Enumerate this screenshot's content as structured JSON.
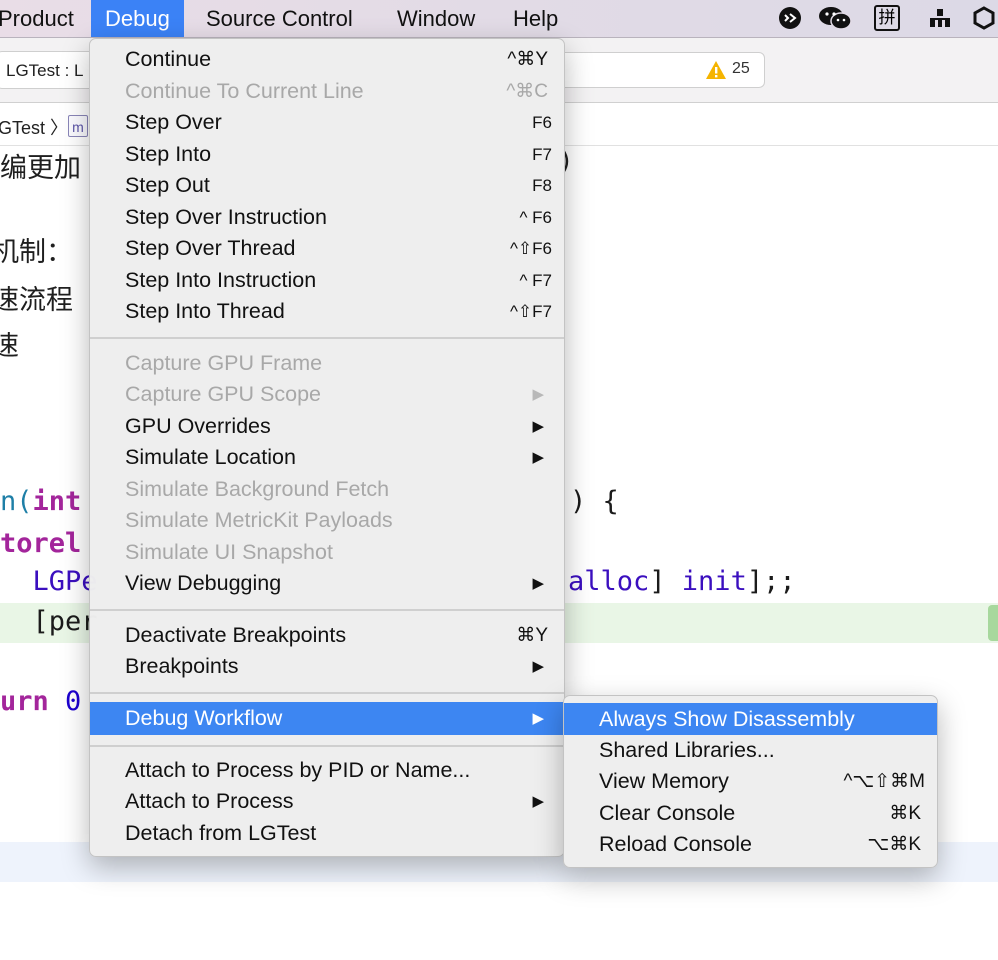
{
  "menubar": {
    "items": [
      {
        "label": "Product"
      },
      {
        "label": "Debug"
      },
      {
        "label": "Source Control"
      },
      {
        "label": "Window"
      },
      {
        "label": "Help"
      }
    ],
    "tray_icons": [
      "cat-icon",
      "wechat-icon",
      "pinyin-input-icon",
      "dock-icon",
      "hexagon-icon"
    ],
    "tray_text": {
      "pinyin": "拼"
    }
  },
  "toolbar": {
    "scheme": "LGTest : L",
    "warnings": "25"
  },
  "jumpbar": {
    "crumb": "GTest 〉",
    "file_badge": "m"
  },
  "editor": {
    "lines": [
      {
        "text": "编更加"
      },
      {
        "text": ")"
      },
      {
        "text": "机制："
      },
      {
        "text": "速流程"
      },
      {
        "text": "速"
      },
      {
        "pre": "n(",
        "kw": "int",
        "post": ""
      },
      {
        "suffix": ") {"
      },
      {
        "kw": "torel"
      },
      {
        "text": "  LGPe"
      },
      {
        "method": "alloc",
        "method2": "init",
        "tail": "];;"
      },
      {
        "text": "  [per"
      },
      {
        "kw": "urn",
        "num": "0"
      }
    ]
  },
  "debug_menu": {
    "items": [
      {
        "label": "Continue",
        "shortcut": "^⌘Y",
        "enabled": true
      },
      {
        "label": "Continue To Current Line",
        "shortcut": "^⌘C",
        "enabled": false
      },
      {
        "label": "Step Over",
        "shortcut": "F6",
        "enabled": true
      },
      {
        "label": "Step Into",
        "shortcut": "F7",
        "enabled": true
      },
      {
        "label": "Step Out",
        "shortcut": "F8",
        "enabled": true
      },
      {
        "label": "Step Over Instruction",
        "shortcut": "^ F6",
        "enabled": true
      },
      {
        "label": "Step Over Thread",
        "shortcut": "^⇧F6",
        "enabled": true
      },
      {
        "label": "Step Into Instruction",
        "shortcut": "^ F7",
        "enabled": true
      },
      {
        "label": "Step Into Thread",
        "shortcut": "^⇧F7",
        "enabled": true
      },
      {
        "label": "Capture GPU Frame",
        "enabled": false
      },
      {
        "label": "Capture GPU Scope",
        "submenu": true,
        "enabled": false
      },
      {
        "label": "GPU Overrides",
        "submenu": true,
        "enabled": true
      },
      {
        "label": "Simulate Location",
        "submenu": true,
        "enabled": true
      },
      {
        "label": "Simulate Background Fetch",
        "enabled": false
      },
      {
        "label": "Simulate MetricKit Payloads",
        "enabled": false
      },
      {
        "label": "Simulate UI Snapshot",
        "enabled": false
      },
      {
        "label": "View Debugging",
        "submenu": true,
        "enabled": true
      },
      {
        "label": "Deactivate Breakpoints",
        "shortcut": "⌘Y",
        "enabled": true
      },
      {
        "label": "Breakpoints",
        "submenu": true,
        "enabled": true
      },
      {
        "label": "Debug Workflow",
        "submenu": true,
        "enabled": true,
        "highlighted": true
      },
      {
        "label": "Attach to Process by PID or Name...",
        "enabled": true
      },
      {
        "label": "Attach to Process",
        "submenu": true,
        "enabled": true
      },
      {
        "label": "Detach from LGTest",
        "enabled": true
      }
    ],
    "arrow": "▶"
  },
  "workflow_submenu": {
    "items": [
      {
        "label": "Always Show Disassembly",
        "highlighted": true
      },
      {
        "label": "Shared Libraries..."
      },
      {
        "label": "View Memory",
        "shortcut": "^⌥⇧⌘M"
      },
      {
        "label": "Clear Console",
        "shortcut": "⌘K"
      },
      {
        "label": "Reload Console",
        "shortcut": "⌥⌘K"
      }
    ]
  },
  "colors": {
    "menu_highlight": "#3d86f2",
    "menubar_active": "#3b82f6",
    "warning": "#f5b400",
    "keyword": "#a3259b"
  }
}
